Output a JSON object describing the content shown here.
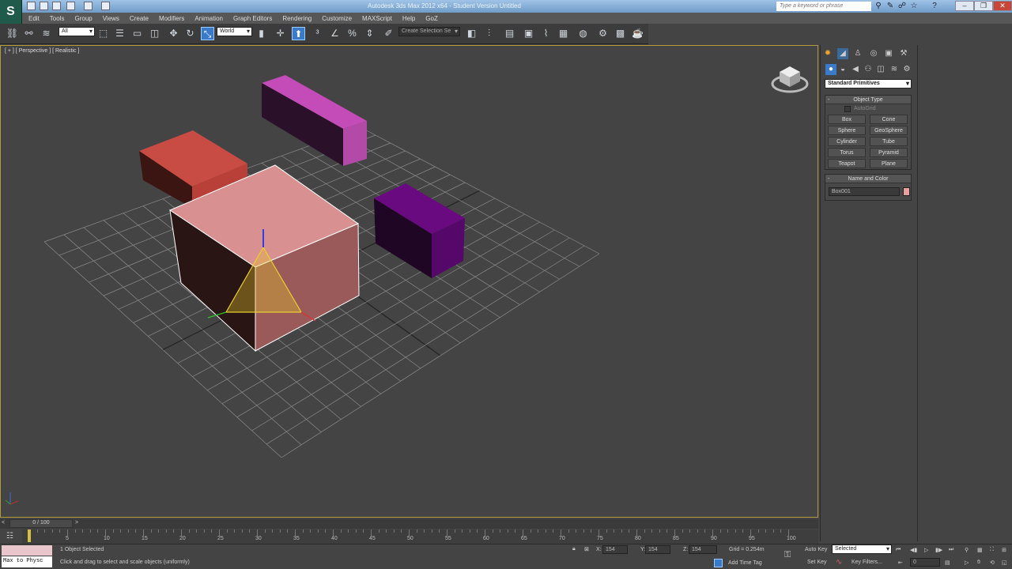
{
  "title": "Autodesk 3ds Max 2012 x64 - Student Version   Untitled",
  "search": {
    "placeholder": "Type a keyword or phrase"
  },
  "menu": [
    "Edit",
    "Tools",
    "Group",
    "Views",
    "Create",
    "Modifiers",
    "Animation",
    "Graph Editors",
    "Rendering",
    "Customize",
    "MAXScript",
    "Help",
    "GoZ"
  ],
  "toolbar": {
    "selection_filter": "All",
    "coord_system": "World",
    "named_selection": "Create Selection Se"
  },
  "viewport": {
    "label": "[ + ] [ Perspective ] [ Realistic ]"
  },
  "command_panel": {
    "category": "Standard Primitives",
    "object_type_title": "Object Type",
    "autogrid": "AutoGrid",
    "buttons": [
      "Box",
      "Cone",
      "Sphere",
      "GeoSphere",
      "Cylinder",
      "Tube",
      "Torus",
      "Pyramid",
      "Teapot",
      "Plane"
    ],
    "name_color_title": "Name and Color",
    "object_name": "Box001",
    "object_color": "#e8a0a0"
  },
  "timeline": {
    "frame": "0 / 100",
    "ticks": [
      "0",
      "5",
      "10",
      "15",
      "20",
      "25",
      "30",
      "35",
      "40",
      "45",
      "50",
      "55",
      "60",
      "65",
      "70",
      "75",
      "80",
      "85",
      "90",
      "95",
      "100"
    ]
  },
  "status": {
    "maxscript": "Max to Physc",
    "selected": "1 Object Selected",
    "prompt": "Click and drag to select and scale objects (uniformly)",
    "x_label": "X:",
    "x": "154",
    "y_label": "Y:",
    "y": "154",
    "z_label": "Z:",
    "z": "154",
    "grid": "Grid = 0.254m",
    "add_time_tag": "Add Time Tag",
    "auto_key": "Auto Key",
    "set_key": "Set Key",
    "key_mode": "Selected",
    "key_filters": "Key Filters...",
    "current_frame": "0"
  },
  "colors": {
    "accent": "#3b7ac8",
    "viewport_border": "#b49a3c"
  }
}
